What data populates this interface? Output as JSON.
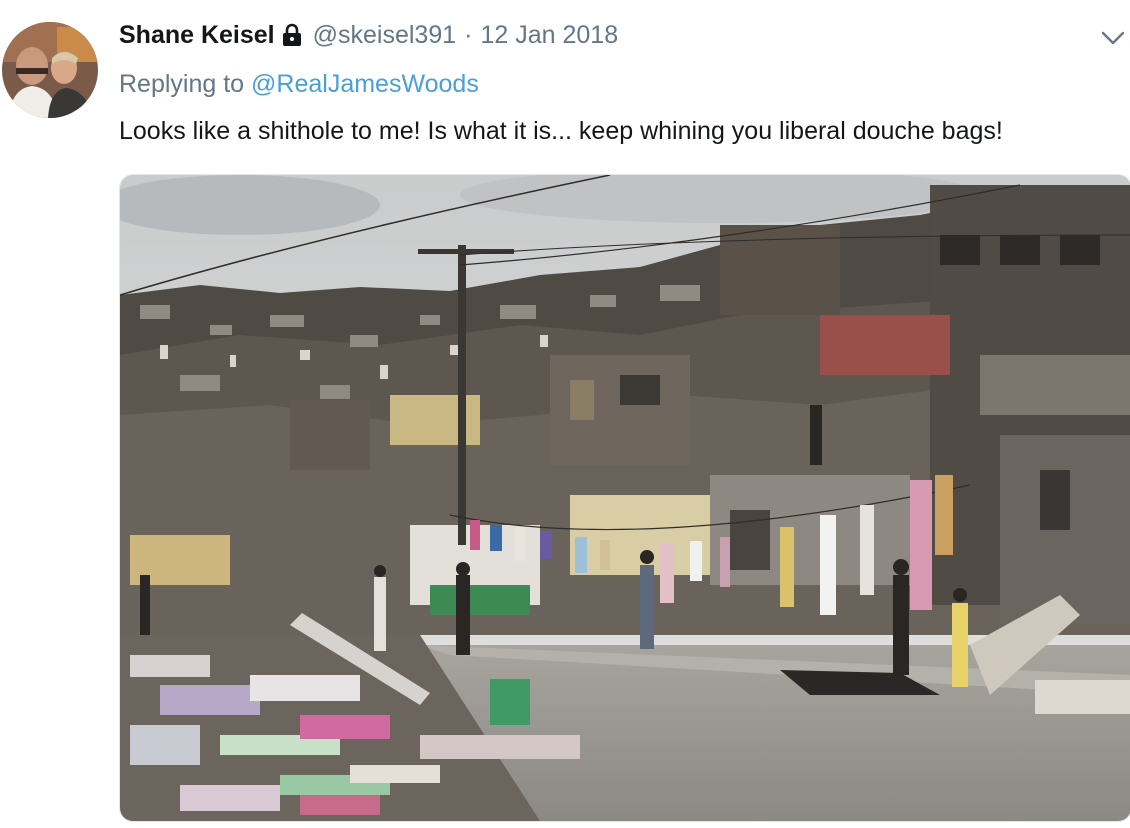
{
  "tweet": {
    "display_name": "Shane Keisel",
    "handle": "@skeisel391",
    "separator": "·",
    "date": "12 Jan 2018",
    "replying_prefix": "Replying to",
    "replying_to": "@RealJamesWoods",
    "text": "Looks like a shithole to me! Is what it is... keep whining you liberal douche bags!"
  },
  "icons": {
    "lock": "lock-icon",
    "caret": "chevron-down-icon"
  },
  "colors": {
    "name": "#14171a",
    "muted": "#657786",
    "link": "#4aa0d5"
  }
}
